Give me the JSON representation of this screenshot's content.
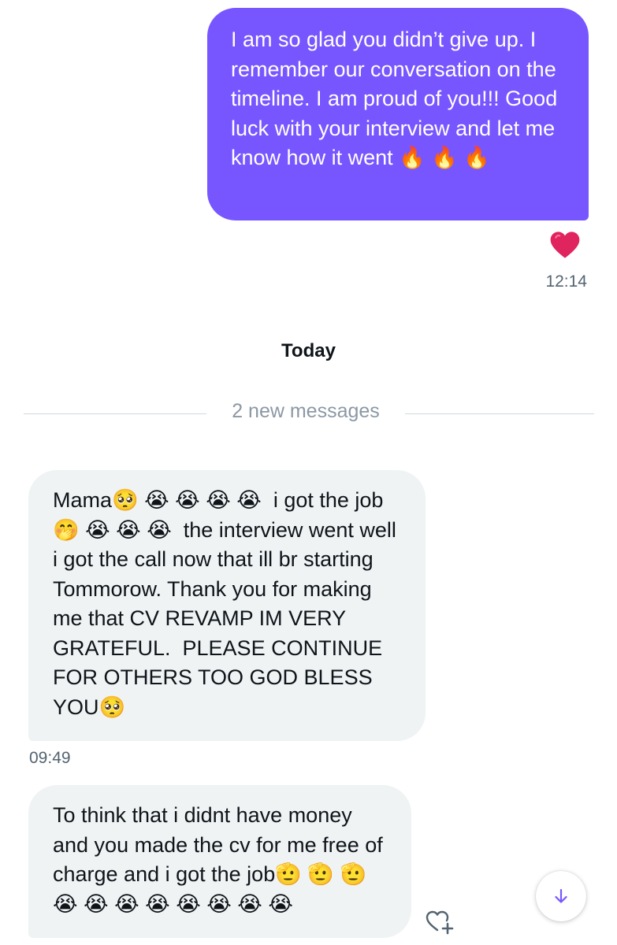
{
  "conversation": {
    "sent": {
      "text": "I am so glad you didn’t give up. I remember our conversation on the timeline. I am proud of you!!! Good luck with your interview and let me know how it went 🔥 🔥 🔥",
      "reaction": "heart-icon",
      "time": "12:14"
    },
    "date_separator": "Today",
    "new_messages_label": "2 new messages",
    "received": [
      {
        "text": "Mama🥺 😭 😭 😭 😭  i got the job🤭 😭 😭 😭  the interview went well i got the call now that ill br starting Tommorow. Thank you for making me that CV REVAMP IM VERY GRATEFUL.  PLEASE CONTINUE FOR OTHERS TOO GOD BLESS YOU🥺",
        "time": "09:49"
      },
      {
        "text": "To think that i didnt have money and you made the cv for me free of charge and i got the job🫡 🫡 🫡 😭 😭 😭 😭 😭 😭 😭 😭"
      }
    ]
  },
  "icons": {
    "scroll_down": "arrow-down-icon",
    "add_reaction": "heart-plus-icon"
  },
  "colors": {
    "sent_bubble": "#7856ff",
    "received_bubble": "#eff3f4",
    "accent": "#7856ff"
  }
}
